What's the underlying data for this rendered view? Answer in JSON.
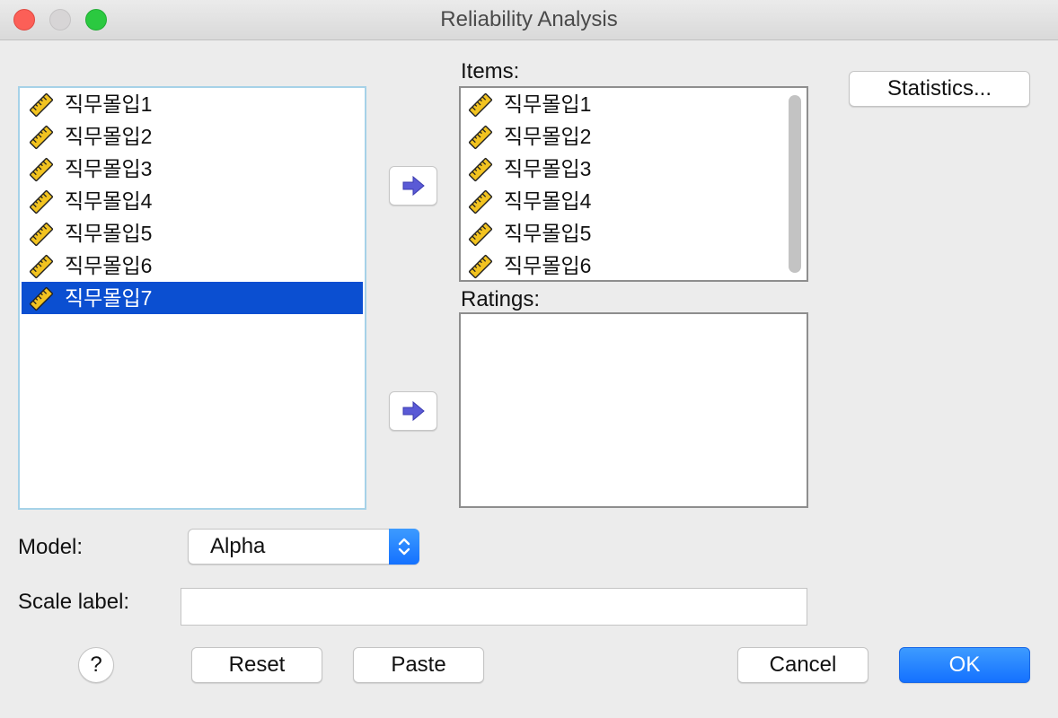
{
  "window": {
    "title": "Reliability Analysis"
  },
  "source_variables": [
    {
      "label": "직무몰입1",
      "icon": "scale-ruler-icon",
      "selected": false
    },
    {
      "label": "직무몰입2",
      "icon": "scale-ruler-icon",
      "selected": false
    },
    {
      "label": "직무몰입3",
      "icon": "scale-ruler-icon",
      "selected": false
    },
    {
      "label": "직무몰입4",
      "icon": "scale-ruler-icon",
      "selected": false
    },
    {
      "label": "직무몰입5",
      "icon": "scale-ruler-icon",
      "selected": false
    },
    {
      "label": "직무몰입6",
      "icon": "scale-ruler-icon",
      "selected": false
    },
    {
      "label": "직무몰입7",
      "icon": "scale-ruler-icon",
      "selected": true
    }
  ],
  "items": {
    "label": "Items:",
    "variables": [
      {
        "label": "직무몰입1",
        "icon": "scale-ruler-icon"
      },
      {
        "label": "직무몰입2",
        "icon": "scale-ruler-icon"
      },
      {
        "label": "직무몰입3",
        "icon": "scale-ruler-icon"
      },
      {
        "label": "직무몰입4",
        "icon": "scale-ruler-icon"
      },
      {
        "label": "직무몰입5",
        "icon": "scale-ruler-icon"
      },
      {
        "label": "직무몰입6",
        "icon": "scale-ruler-icon"
      }
    ]
  },
  "ratings": {
    "label": "Ratings:",
    "variables": []
  },
  "statistics_button": "Statistics...",
  "model": {
    "label": "Model:",
    "selected": "Alpha"
  },
  "scale_label": {
    "label": "Scale label:",
    "value": ""
  },
  "buttons": {
    "help": "?",
    "reset": "Reset",
    "paste": "Paste",
    "cancel": "Cancel",
    "ok": "OK"
  },
  "colors": {
    "selection": "#0b4fd1",
    "primary_button": "#1471ff",
    "arrow": "#5a5ad6",
    "ruler_icon": "#f2c320"
  }
}
